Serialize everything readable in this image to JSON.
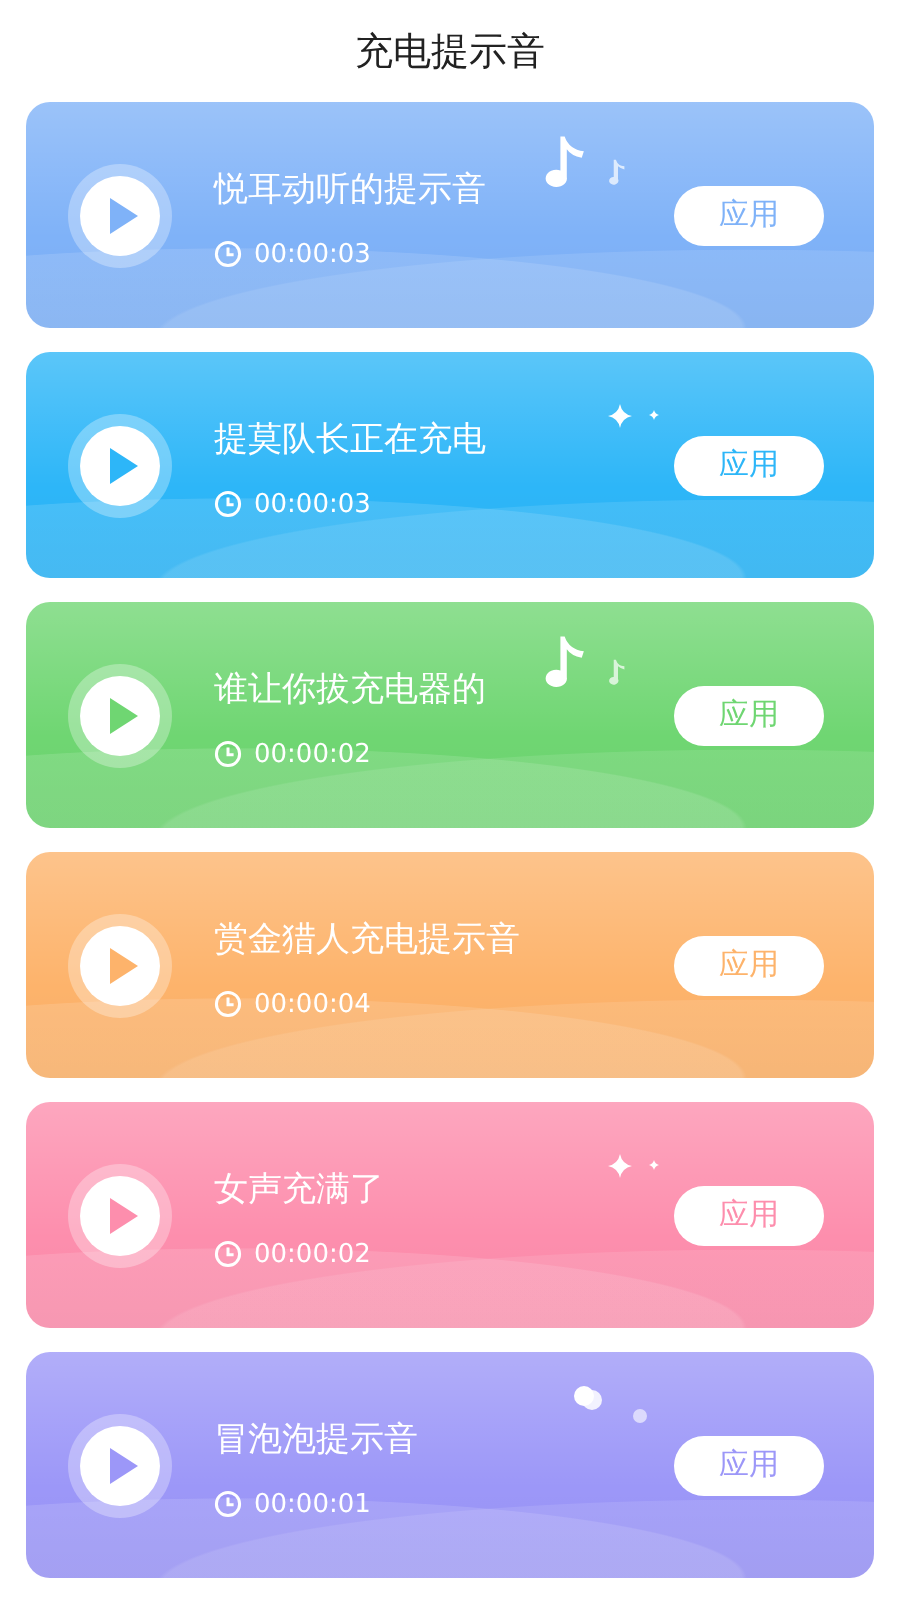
{
  "title": "充电提示音",
  "sounds": [
    {
      "name": "悦耳动听的提示音",
      "duration": "00:00:03",
      "button": "应用",
      "color": "#7fb2f8",
      "kind": "note"
    },
    {
      "name": "提莫队长正在充电",
      "duration": "00:00:03",
      "button": "应用",
      "color": "#2db6f8",
      "kind": "sparkle"
    },
    {
      "name": "谁让你拔充电器的",
      "duration": "00:00:02",
      "button": "应用",
      "color": "#6fd672",
      "kind": "note"
    },
    {
      "name": "赏金猎人充电提示音",
      "duration": "00:00:04",
      "button": "应用",
      "color": "#fdb36b",
      "kind": "plain"
    },
    {
      "name": "女声充满了",
      "duration": "00:00:02",
      "button": "应用",
      "color": "#fd8ead",
      "kind": "sparkle"
    },
    {
      "name": "冒泡泡提示音",
      "duration": "00:00:01",
      "button": "应用",
      "color": "#9c97f8",
      "kind": "bubble"
    }
  ]
}
